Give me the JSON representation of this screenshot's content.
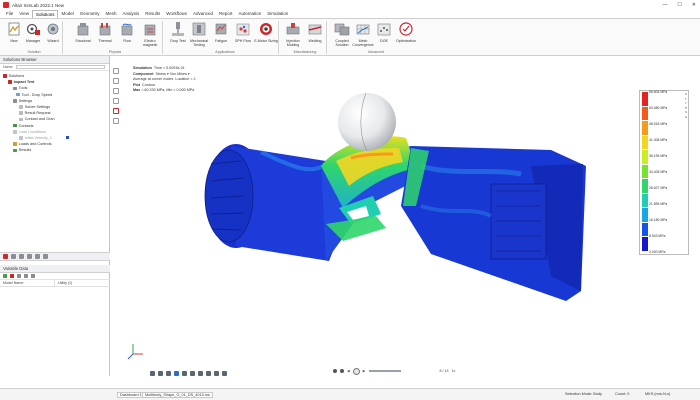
{
  "window": {
    "title": "Altair SimLab 2022.1 New",
    "controls": [
      "—",
      "☐",
      "✕"
    ]
  },
  "menu": {
    "tabs": [
      "File",
      "View",
      "Solutions",
      "Model",
      "Geometry",
      "Mesh",
      "Analysis",
      "Results",
      "Workflows",
      "Advanced",
      "Report",
      "Automation",
      "Simulation"
    ],
    "active_index": 2
  },
  "ribbon": {
    "buttons": [
      "New",
      "Manager",
      "Wizard",
      "Structural",
      "Thermal",
      "Flow",
      "Electro magnetic",
      "Drop Test",
      "Mechanical Testing",
      "Fatigue",
      "SPH Flow",
      "E-Motor Sizing",
      "Injection Molding",
      "Welding",
      "Coupled Solution",
      "Mesh Convergence",
      "DOE",
      "Optimization"
    ],
    "groups": [
      "Solution",
      "Physics",
      "Applications",
      "Manufacturing",
      "Advanced"
    ]
  },
  "left_panel": {
    "browser_title": "Solutions Browser",
    "filter": "Name",
    "tree": [
      "Solutions",
      "Impact Test",
      "Tools",
      "Tool - Drop Speed",
      "Settings",
      "Solver Settings",
      "Result Request",
      "Contact and Gran",
      "Contacts",
      "Load Conditions",
      "Initial Velocity_1",
      "Loads and Controls",
      "Results"
    ],
    "bottom_title": "Variable Data",
    "col_model": "Model Name",
    "col_value": "Utility (1)"
  },
  "viewport": {
    "info": [
      {
        "label": "Simulation",
        "value": "Time = 0.0093e-01"
      },
      {
        "label": "Component",
        "value": "Stress  ▾  Von Mises  ▾"
      },
      {
        "label": "Average at corner nodes",
        "value": "Location = 2"
      },
      {
        "label": "Plot",
        "value": "Contour"
      },
      {
        "label": "Max",
        "value": "= 60.330 MPa, Min = 0.000 MPa"
      }
    ]
  },
  "legend": {
    "values": [
      "56.604 MPa",
      "53.480 MPa",
      "48.518 MPa",
      "41.308 MPa",
      "36.195 MPa",
      "34.405 MPa",
      "28.627 MPa",
      "21.895 MPa",
      "16.180 MPa",
      "8.943 MPa",
      "0.000 MPa"
    ],
    "colors": [
      "#e5231f",
      "#f45b16",
      "#f79a1a",
      "#f3d622",
      "#c9ef1f",
      "#76e32c",
      "#2fd66a",
      "#1fcfb0",
      "#16a7e8",
      "#1553ee",
      "#1518c8"
    ],
    "unit_stack": [
      "s",
      "t",
      "r",
      "e",
      "s",
      "s"
    ]
  },
  "playback": {
    "frame": "8 / 15",
    "speed": "1x"
  },
  "status": {
    "sheet": "Dashboard 1",
    "mode": "Selection Mode: Body",
    "count": "Count: 0",
    "units": "MKS (mm-N-s)"
  },
  "bottom_tab": "Multibody_Shape_G_01_DS_4013.ms"
}
